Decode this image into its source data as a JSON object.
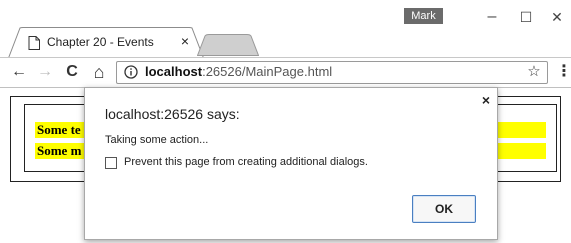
{
  "window": {
    "profile_name": "Mark",
    "minimize_glyph": "–",
    "maximize_glyph": "☐",
    "close_glyph": "✕"
  },
  "tab": {
    "title": "Chapter 20 - Events",
    "close_glyph": "×",
    "favicon": "page-icon"
  },
  "toolbar": {
    "back_glyph": "←",
    "forward_glyph": "→",
    "reload_glyph": "C",
    "home_glyph": "⌂",
    "url_host": "localhost",
    "url_rest": ":26526/MainPage.html",
    "star_glyph": "☆",
    "menu_glyph": "⋮"
  },
  "page": {
    "rows": [
      {
        "text": "Some te"
      },
      {
        "text": "Some m"
      }
    ],
    "highlight_color": "#ffff00"
  },
  "dialog": {
    "title": "localhost:26526 says:",
    "close_glyph": "×",
    "message": "Taking some action...",
    "checkbox_label": "Prevent this page from creating additional dialogs.",
    "checkbox_checked": false,
    "ok_label": "OK",
    "ok_border_color": "#4a7fc1"
  }
}
